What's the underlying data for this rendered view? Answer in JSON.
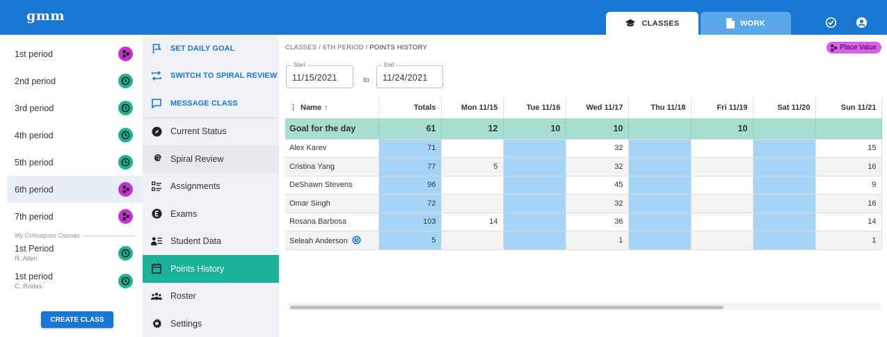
{
  "app": {
    "logo": "gmm"
  },
  "header": {
    "tabs": [
      {
        "label": "CLASSES",
        "icon": "graduation-cap-icon",
        "active": true
      },
      {
        "label": "WORK",
        "icon": "document-icon",
        "active": false
      }
    ],
    "icons": [
      "check-circle-icon",
      "account-icon"
    ]
  },
  "classes": {
    "items": [
      {
        "label": "1st period",
        "badge": "purple",
        "badge_icon": "place-value-icon"
      },
      {
        "label": "2nd period",
        "badge": "teal",
        "badge_icon": "history-icon"
      },
      {
        "label": "3rd period",
        "badge": "teal",
        "badge_icon": "history-icon"
      },
      {
        "label": "4th period",
        "badge": "teal",
        "badge_icon": "history-icon"
      },
      {
        "label": "5th period",
        "badge": "teal",
        "badge_icon": "history-icon"
      },
      {
        "label": "6th period",
        "badge": "purple",
        "badge_icon": "place-value-icon",
        "active": true
      },
      {
        "label": "7th period",
        "badge": "purple",
        "badge_icon": "place-value-icon"
      }
    ],
    "colleagues_label": "My Colleagues Classes",
    "colleagues": [
      {
        "label": "1st Period",
        "teacher": "R. Allen",
        "badge": "teal"
      },
      {
        "label": "1st period",
        "teacher": "C. Rodas",
        "badge": "teal"
      }
    ],
    "create_label": "CREATE CLASS"
  },
  "menu": {
    "actions": [
      {
        "label": "SET DAILY GOAL",
        "icon": "flag-icon"
      },
      {
        "label": "SWITCH TO SPIRAL REVIEW",
        "icon": "swap-icon"
      },
      {
        "label": "MESSAGE CLASS",
        "icon": "message-icon"
      }
    ],
    "items": [
      {
        "label": "Current Status",
        "icon": "compass-icon"
      },
      {
        "label": "Spiral Review",
        "icon": "spiral-icon"
      },
      {
        "label": "Assignments",
        "icon": "checklist-icon"
      },
      {
        "label": "Exams",
        "icon": "exam-icon"
      },
      {
        "label": "Student Data",
        "icon": "student-data-icon"
      },
      {
        "label": "Points History",
        "icon": "calendar-icon",
        "active": true
      },
      {
        "label": "Roster",
        "icon": "group-icon"
      },
      {
        "label": "Settings",
        "icon": "gear-icon"
      }
    ]
  },
  "main": {
    "breadcrumb": [
      "CLASSES",
      "6TH PERIOD",
      "POINTS HISTORY"
    ],
    "pill_label": "Place Value",
    "pill_color": "#d85de8",
    "start": {
      "label": "Start",
      "value": "11/15/2021"
    },
    "end": {
      "label": "End",
      "value": "11/24/2021"
    },
    "to_label": "to"
  },
  "table": {
    "headers": [
      "Name",
      "Totals",
      "Mon 11/15",
      "Tue 11/16",
      "Wed 11/17",
      "Thu 11/18",
      "Fri 11/19",
      "Sat 11/20",
      "Sun 11/21"
    ],
    "goal": [
      "Goal for the day",
      "61",
      "12",
      "10",
      "10",
      "",
      "10",
      "",
      ""
    ],
    "rows": [
      [
        "Alex Karev",
        "71",
        "",
        "",
        "32",
        "",
        "",
        "",
        "15"
      ],
      [
        "Cristina Yang",
        "77",
        "5",
        "",
        "32",
        "",
        "",
        "",
        "16"
      ],
      [
        "DeShawn Stevens",
        "96",
        "",
        "",
        "45",
        "",
        "",
        "",
        "9"
      ],
      [
        "Omar Singh",
        "72",
        "",
        "",
        "32",
        "",
        "",
        "",
        "16"
      ],
      [
        "Rosana Barbosa",
        "103",
        "14",
        "",
        "36",
        "",
        "",
        "",
        "14"
      ],
      [
        "Seleah Anderson",
        "5",
        "",
        "",
        "1",
        "",
        "",
        "",
        "1"
      ]
    ]
  },
  "colors": {
    "header_blue": "#1976d2",
    "teal": "#1ab39a",
    "purple": "#c42fd8",
    "goal_row": "#a7ded2",
    "cell_blue": "#a6d4f7"
  }
}
